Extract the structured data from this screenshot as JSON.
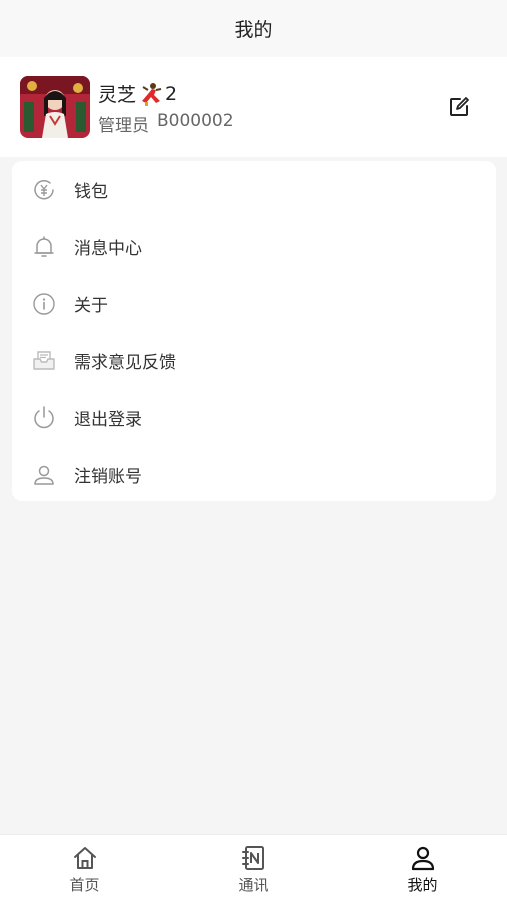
{
  "header": {
    "title": "我的"
  },
  "profile": {
    "name": "灵芝",
    "name_suffix": "2",
    "role": "管理员",
    "user_id": "B000002",
    "avatar_icon": "user-photo",
    "badge_icon": "dancer-emoji",
    "edit_icon": "edit-icon"
  },
  "menu": {
    "items": [
      {
        "label": "钱包",
        "icon": "yuan-coin-icon"
      },
      {
        "label": "消息中心",
        "icon": "bell-icon"
      },
      {
        "label": "关于",
        "icon": "info-icon"
      },
      {
        "label": "需求意见反馈",
        "icon": "feedback-inbox-icon"
      },
      {
        "label": "退出登录",
        "icon": "power-icon"
      },
      {
        "label": "注销账号",
        "icon": "user-icon"
      }
    ]
  },
  "tabbar": {
    "tabs": [
      {
        "label": "首页",
        "icon": "home-icon",
        "active": false
      },
      {
        "label": "通讯",
        "icon": "contacts-icon",
        "active": false
      },
      {
        "label": "我的",
        "icon": "person-icon",
        "active": true
      }
    ]
  },
  "colors": {
    "background": "#f5f5f5",
    "card": "#ffffff",
    "text_primary": "#222222",
    "text_secondary": "#666666",
    "icon_gray": "#999999"
  }
}
